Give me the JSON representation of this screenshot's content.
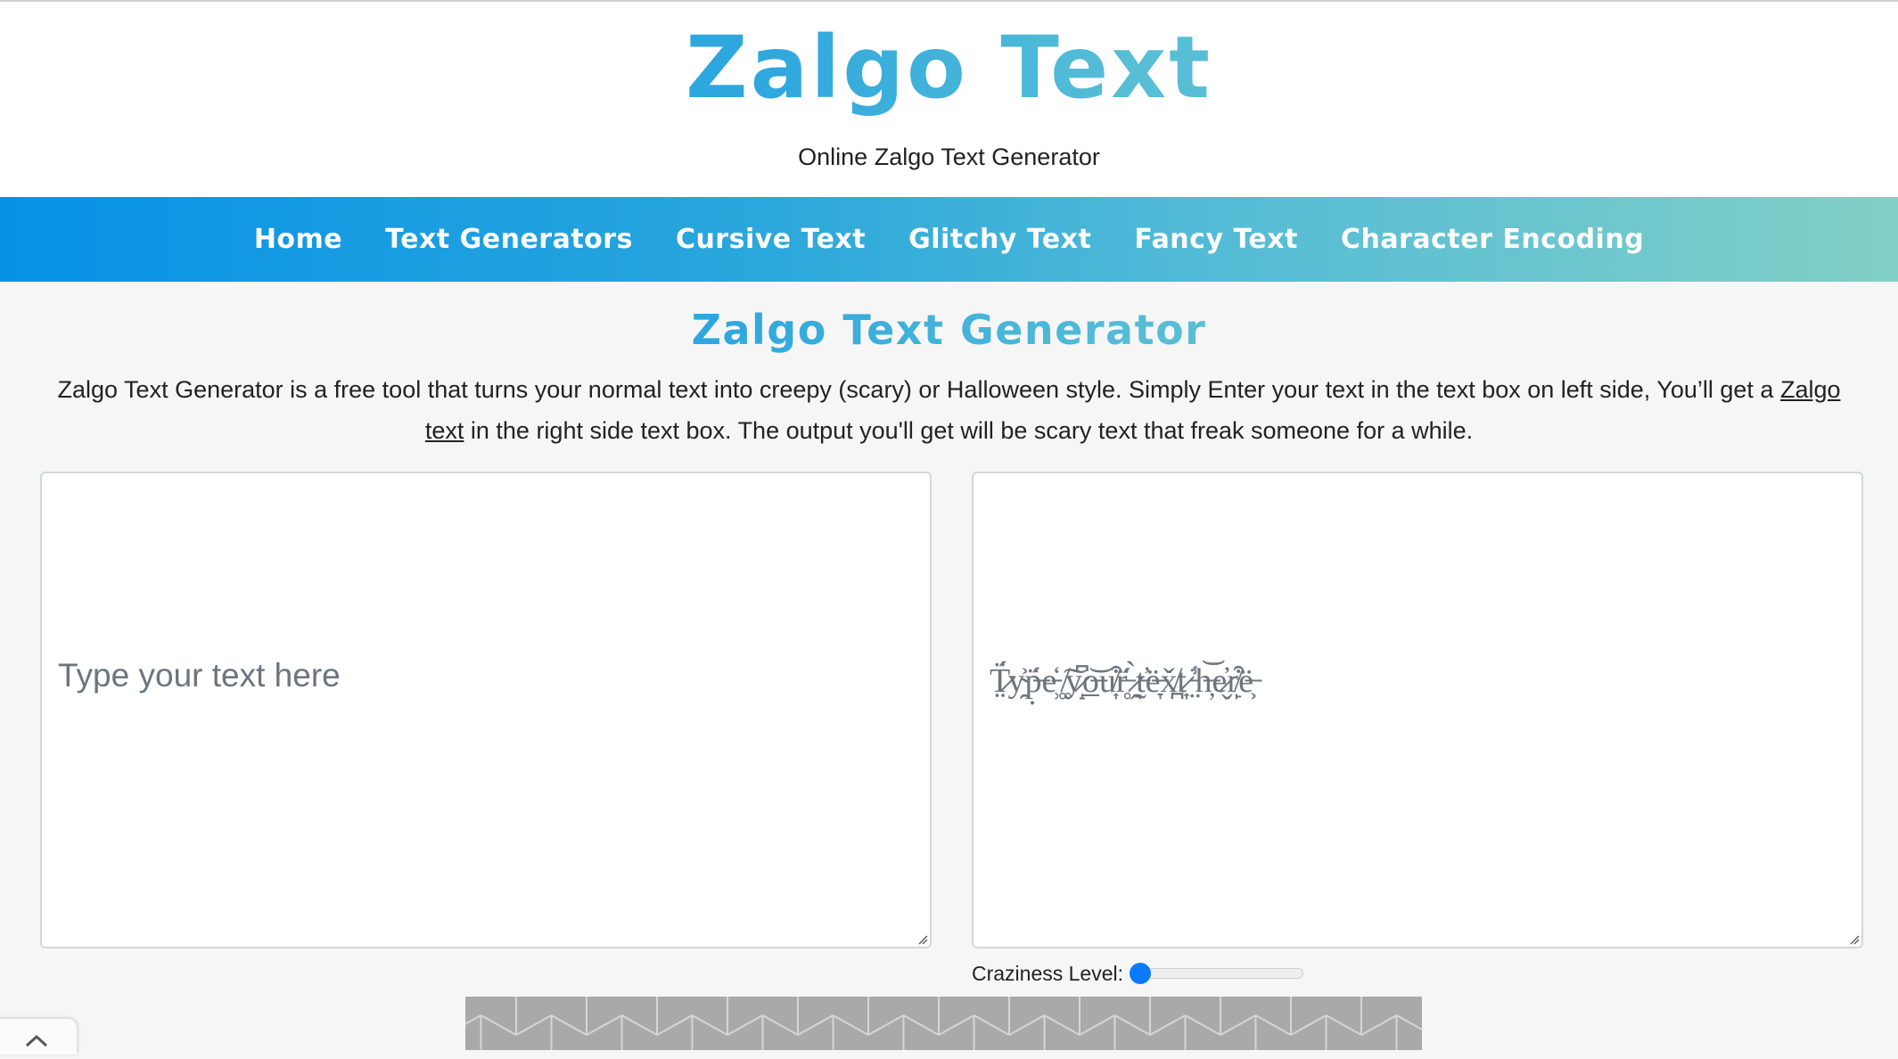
{
  "header": {
    "title": "Zalgo Text",
    "subtitle": "Online Zalgo Text Generator"
  },
  "nav": {
    "items": [
      {
        "label": "Home"
      },
      {
        "label": "Text Generators"
      },
      {
        "label": "Cursive Text"
      },
      {
        "label": "Glitchy Text"
      },
      {
        "label": "Fancy Text"
      },
      {
        "label": "Character Encoding"
      }
    ]
  },
  "main": {
    "heading": "Zalgo Text Generator",
    "intro_before_link": "Zalgo Text Generator is a free tool that turns your normal text into creepy (scary) or Halloween style. Simply Enter your text in the text box on left side, You’ll get a ",
    "intro_link": "Zalgo text",
    "intro_after_link": " in the right side text box. The output you'll get will be scary text that freak someone for a while.",
    "input": {
      "value": "",
      "placeholder": "Type your text here"
    },
    "output": {
      "value": "",
      "placeholder_zalgo": "T̷̤̈́y̴̯͐p̶̣̈́e̵̹̒ ̸͚͠y̷̝͆o̶̲͝u̸͎͒r̶̥̈́ ̷̭̀t̵̰̕ë̶̞x̸̪̌t̷͎͘ ̵̤̾h̶̦͝e̷̬̓r̸̙͒ë̶͕"
    },
    "craziness": {
      "label": "Craziness Level:",
      "value_fraction": 0.0
    }
  },
  "colors": {
    "brand_blue": "#2ea7df",
    "brand_teal": "#82d0c6",
    "slider_thumb": "#0a7bff"
  },
  "icons": {
    "scroll_top": "chevron-up-icon",
    "resize": "resize-grip-icon"
  }
}
